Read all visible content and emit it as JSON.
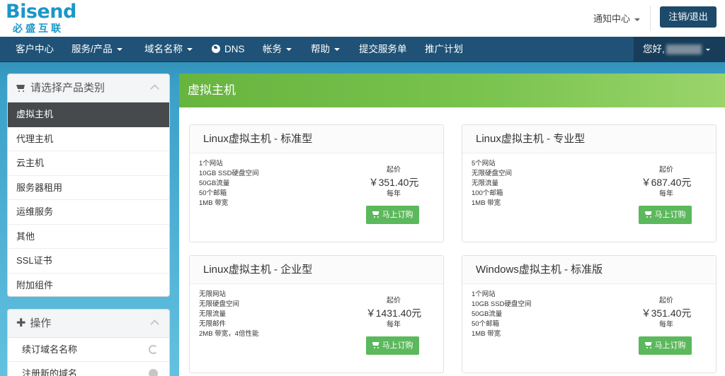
{
  "header": {
    "logo_text": "Bisend",
    "logo_sub": "必盛互联",
    "notifications_label": "通知中心",
    "logout_label": "注销/退出"
  },
  "nav": {
    "items": [
      {
        "label": "客户中心"
      },
      {
        "label": "服务/产品"
      },
      {
        "label": "域名名称"
      },
      {
        "label": "DNS"
      },
      {
        "label": "帐务"
      },
      {
        "label": "帮助"
      },
      {
        "label": "提交服务单"
      },
      {
        "label": "推广计划"
      }
    ],
    "greeting": "您好,"
  },
  "sidebar": {
    "category_title": "请选择产品类别",
    "categories": [
      {
        "label": "虚拟主机"
      },
      {
        "label": "代理主机"
      },
      {
        "label": "云主机"
      },
      {
        "label": "服务器租用"
      },
      {
        "label": "运维服务"
      },
      {
        "label": "其他"
      },
      {
        "label": "SSL证书"
      },
      {
        "label": "附加组件"
      }
    ],
    "actions_title": "操作",
    "actions": [
      {
        "label": "续订域名名称"
      },
      {
        "label": "注册新的域名"
      }
    ]
  },
  "main": {
    "title": "虚拟主机",
    "from_label": "起价",
    "period_label": "每年",
    "order_label": "马上订购",
    "products": [
      {
        "name": "Linux虚拟主机 - 标准型",
        "features": [
          "1个网站",
          "10GB SSD硬盘空间",
          "50GB流量",
          "50个邮箱",
          "1MB 带宽"
        ],
        "price": "￥351.40元"
      },
      {
        "name": "Linux虚拟主机 - 专业型",
        "features": [
          "5个网站",
          "无限硬盘空间",
          "无限流量",
          "100个邮箱",
          "1MB 带宽"
        ],
        "price": "￥687.40元"
      },
      {
        "name": "Linux虚拟主机 - 企业型",
        "features": [
          "无限网站",
          "无限硬盘空间",
          "无限流量",
          "无限邮件",
          "2MB 带宽，4倍性能"
        ],
        "price": "￥1431.40元"
      },
      {
        "name": "Windows虚拟主机 - 标准版",
        "features": [
          "1个网站",
          "10GB SSD硬盘空间",
          "50GB流量",
          "50个邮箱",
          "1MB 带宽"
        ],
        "price": "￥351.40元"
      }
    ]
  }
}
